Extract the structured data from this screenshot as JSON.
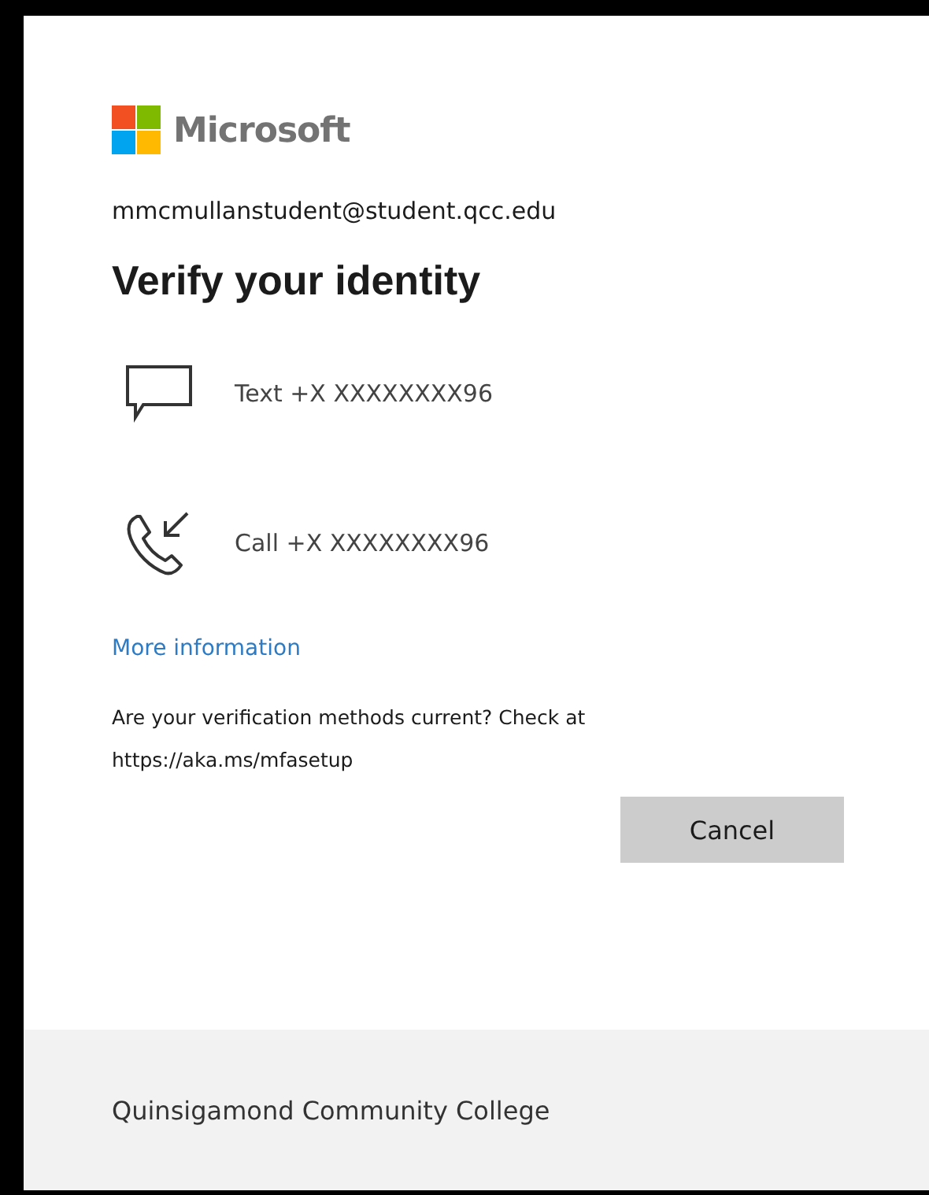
{
  "brand": {
    "name": "Microsoft"
  },
  "account": "mmcmullanstudent@student.qcc.edu",
  "title": "Verify your identity",
  "methods": [
    {
      "kind": "text",
      "label": "Text +X XXXXXXXX96"
    },
    {
      "kind": "call",
      "label": "Call +X XXXXXXXX96"
    }
  ],
  "more_link": "More information",
  "note": "Are your verification methods current? Check at https://aka.ms/mfasetup",
  "buttons": [
    "Cancel"
  ],
  "footer": "Quinsigamond Community College"
}
